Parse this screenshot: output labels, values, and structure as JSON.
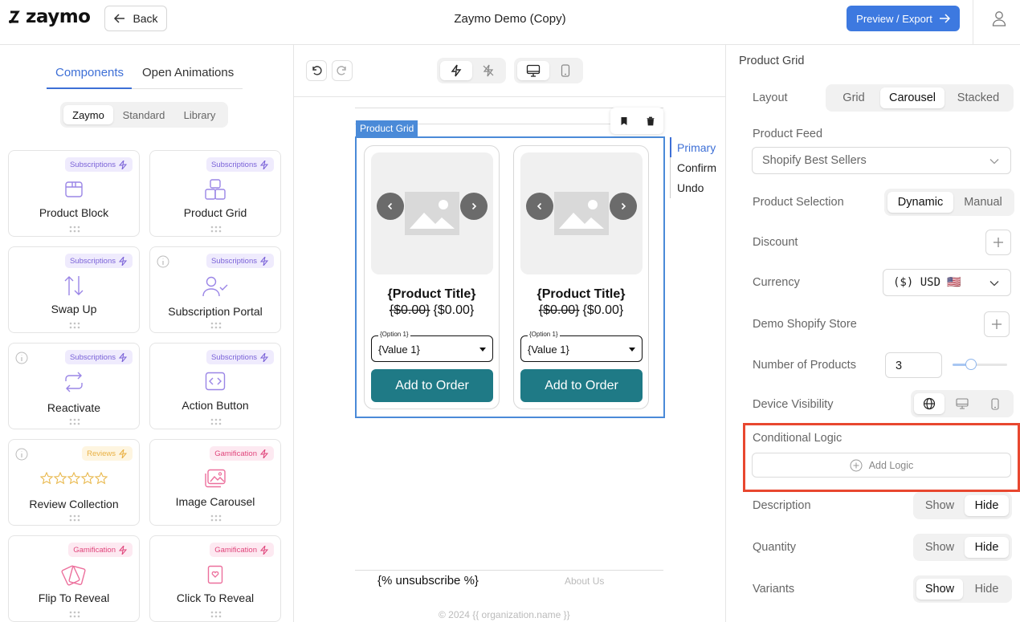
{
  "header": {
    "logo_text": "zaymo",
    "back_label": "Back",
    "title": "Zaymo Demo (Copy)",
    "preview_label": "Preview / Export"
  },
  "left": {
    "tabs": [
      "Components",
      "Open Animations"
    ],
    "active_tab": "Components",
    "segments": [
      "Zaymo",
      "Standard",
      "Library"
    ],
    "active_segment": "Zaymo",
    "cards": [
      {
        "label": "Product Block",
        "badge": "Subscriptions",
        "badge_type": "sub",
        "icon": "box-icon",
        "info": false
      },
      {
        "label": "Product Grid",
        "badge": "Subscriptions",
        "badge_type": "sub",
        "icon": "boxes-icon",
        "info": false
      },
      {
        "label": "Swap Up",
        "badge": "Subscriptions",
        "badge_type": "sub",
        "icon": "swap-arrows-icon",
        "info": false
      },
      {
        "label": "Subscription Portal",
        "badge": "Subscriptions",
        "badge_type": "sub",
        "icon": "user-check-icon",
        "info": true
      },
      {
        "label": "Reactivate",
        "badge": "Subscriptions",
        "badge_type": "sub",
        "icon": "repeat-icon",
        "info": true
      },
      {
        "label": "Action Button",
        "badge": "Subscriptions",
        "badge_type": "sub",
        "icon": "code-square-icon",
        "info": false
      },
      {
        "label": "Review Collection",
        "badge": "Reviews",
        "badge_type": "rev",
        "icon": "stars-icon",
        "info": true
      },
      {
        "label": "Image Carousel",
        "badge": "Gamification",
        "badge_type": "gam",
        "icon": "images-icon",
        "info": false
      },
      {
        "label": "Flip To Reveal",
        "badge": "Gamification",
        "badge_type": "gam",
        "icon": "flip-cards-icon",
        "info": false
      },
      {
        "label": "Click To Reveal",
        "badge": "Gamification",
        "badge_type": "gam",
        "icon": "heart-tag-icon",
        "info": false
      }
    ]
  },
  "canvas": {
    "selected_label": "Product Grid",
    "states": [
      "Primary",
      "Confirm",
      "Undo"
    ],
    "active_state": "Primary",
    "products": [
      {
        "title": "{Product Title}",
        "old_price": "{$0.00}",
        "price": "{$0.00}",
        "option_label": "{Option 1}",
        "option_value": "{Value 1}",
        "button": "Add to Order"
      },
      {
        "title": "{Product Title}",
        "old_price": "{$0.00}",
        "price": "{$0.00}",
        "option_label": "{Option 1}",
        "option_value": "{Value 1}",
        "button": "Add to Order"
      }
    ],
    "footer_unsubscribe": "{% unsubscribe %}",
    "footer_about": "About Us",
    "footer_copyright": "© 2024 {{ organization.name }}"
  },
  "right": {
    "section_title": "Product Grid",
    "layout_label": "Layout",
    "layout_options": [
      "Grid",
      "Carousel",
      "Stacked"
    ],
    "layout_selected": "Carousel",
    "feed_label": "Product Feed",
    "feed_value": "Shopify Best Sellers",
    "selection_label": "Product Selection",
    "selection_options": [
      "Dynamic",
      "Manual"
    ],
    "selection_selected": "Dynamic",
    "discount_label": "Discount",
    "currency_label": "Currency",
    "currency_value": "($) USD 🇺🇸",
    "store_label": "Demo Shopify Store",
    "count_label": "Number of Products",
    "count_value": "3",
    "count_slider_fraction": 0.3,
    "visibility_label": "Device Visibility",
    "visibility_selected": "all",
    "logic_label": "Conditional Logic",
    "add_logic_label": "Add Logic",
    "description_label": "Description",
    "description_options": [
      "Show",
      "Hide"
    ],
    "description_selected": "Hide",
    "quantity_label": "Quantity",
    "quantity_options": [
      "Show",
      "Hide"
    ],
    "quantity_selected": "Hide",
    "variants_label": "Variants",
    "variants_options": [
      "Show",
      "Hide"
    ],
    "variants_selected": "Show"
  },
  "colors": {
    "accent": "#3d79e0",
    "highlight": "#e8472f",
    "button_teal": "#1f7a86"
  }
}
